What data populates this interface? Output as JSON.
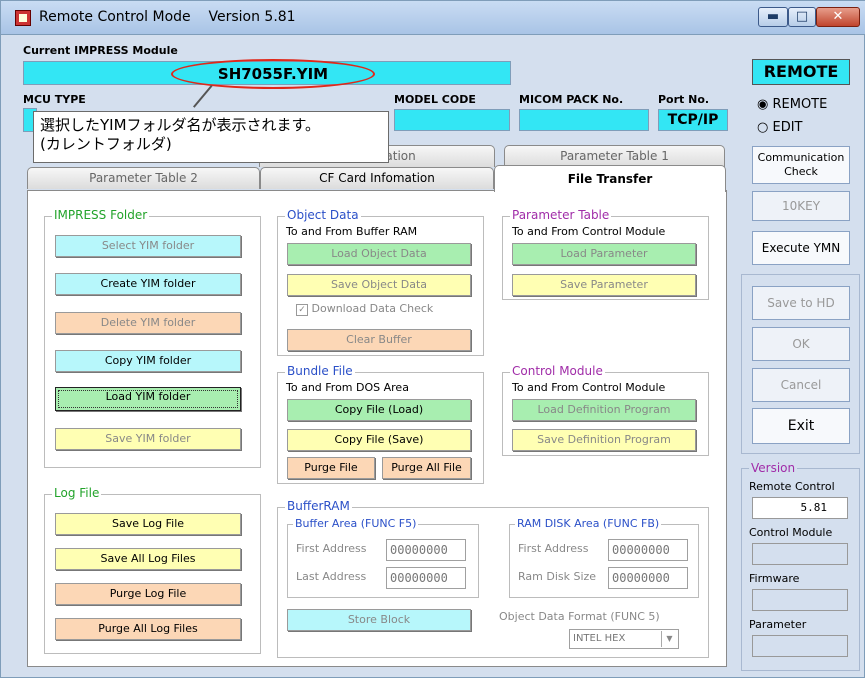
{
  "window": {
    "title": "Remote Control Mode",
    "version": "Version  5.81",
    "minimize": "▬",
    "maximize": "□",
    "close": "✕"
  },
  "impress": {
    "label": "Current IMPRESS Module",
    "module": "SH7055F.YIM",
    "mode": "REMOTE"
  },
  "row2": {
    "mcu_type": "MCU TYPE",
    "model_code": "MODEL CODE",
    "micom_pack": "MICOM PACK No.",
    "port_no": "Port No.",
    "port_value": "TCP/IP"
  },
  "callout": {
    "line1": "選択したYIMフォルダ名が表示されます。",
    "line2": "(カレントフォルダ)"
  },
  "radio": {
    "remote": "REMOTE",
    "edit": "EDIT",
    "remote_mark": "◉",
    "edit_mark": "○"
  },
  "tabs": {
    "operation": "Operation",
    "param1": "Parameter Table 1",
    "param2": "Parameter Table 2",
    "cf_card": "CF Card Infomation",
    "file_transfer": "File Transfer"
  },
  "impress_folder": {
    "title": "IMPRESS Folder",
    "select": "Select YIM folder",
    "create": "Create YIM folder",
    "delete": "Delete YIM folder",
    "copy": "Copy YIM folder",
    "load": "Load YIM folder",
    "save": "Save YIM folder"
  },
  "log_file": {
    "title": "Log File",
    "save": "Save Log File",
    "save_all": "Save All Log Files",
    "purge": "Purge Log File",
    "purge_all": "Purge All Log Files"
  },
  "object_data": {
    "title": "Object Data",
    "sub": "To and From Buffer RAM",
    "load": "Load Object Data",
    "save": "Save Object Data",
    "check": "Download Data Check",
    "clear": "Clear Buffer"
  },
  "param_table": {
    "title": "Parameter Table",
    "sub": "To and From Control Module",
    "load": "Load Parameter",
    "save": "Save Parameter"
  },
  "bundle": {
    "title": "Bundle File",
    "sub": "To and From DOS Area",
    "copy_load": "Copy File (Load)",
    "copy_save": "Copy File (Save)",
    "purge": "Purge File",
    "purge_all": "Purge All File"
  },
  "control_module": {
    "title": "Control Module",
    "sub": "To and From Control Module",
    "load": "Load Definition Program",
    "save": "Save Definition Program"
  },
  "buffer_ram": {
    "title": "BufferRAM",
    "buffer_area": "Buffer Area (FUNC F5)",
    "first_address": "First Address",
    "last_address": "Last Address",
    "first_value": "00000000",
    "last_value": "00000000",
    "ram_disk": "RAM DISK Area (FUNC FB)",
    "ram_first": "First  Address",
    "ram_size": "Ram Disk Size",
    "ram_first_value": "00000000",
    "ram_size_value": "00000000",
    "store": "Store Block",
    "format_label": "Object Data Format (FUNC 5)",
    "format_value": "INTEL HEX"
  },
  "side": {
    "comm_check": "Communication Check",
    "tenkey": "10KEY",
    "execute": "Execute YMN",
    "save_hd": "Save to HD",
    "ok": "OK",
    "cancel": "Cancel",
    "exit": "Exit"
  },
  "version": {
    "title": "Version",
    "remote": "Remote Control",
    "remote_value": "5.81",
    "control": "Control Module",
    "firmware": "Firmware",
    "parameter": "Parameter"
  }
}
